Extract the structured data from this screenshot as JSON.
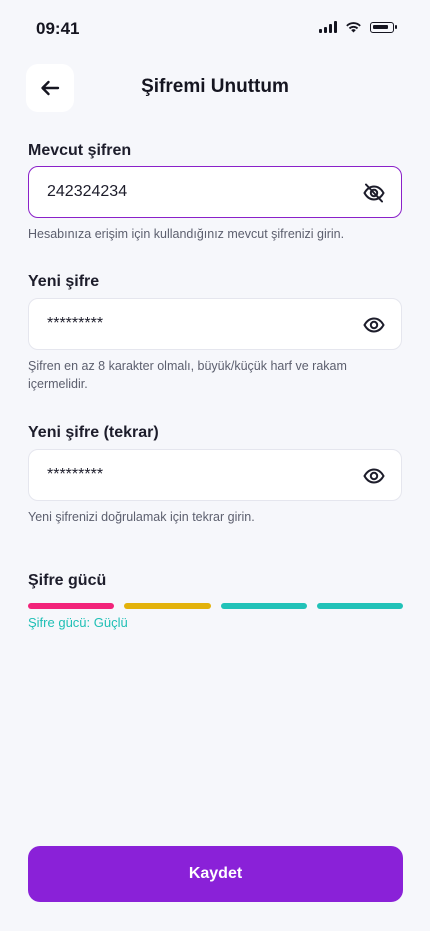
{
  "status_bar": {
    "time": "09:41"
  },
  "header": {
    "title": "Şifremi Unuttum",
    "back_icon": "arrow-left-icon"
  },
  "fields": {
    "current": {
      "label": "Mevcut şifren",
      "value": "242324234",
      "helper": "Hesabınıza erişim için kullandığınız mevcut şifrenizi girin.",
      "icon": "eye-off-icon"
    },
    "new": {
      "label": "Yeni şifre",
      "value": "*********",
      "helper": "Şifren en az 8 karakter olmalı, büyük/küçük harf ve rakam içermelidir.",
      "icon": "eye-icon"
    },
    "confirm": {
      "label": "Yeni şifre (tekrar)",
      "value": "*********",
      "helper": "Yeni şifrenizi doğrulamak için tekrar girin.",
      "icon": "eye-icon"
    }
  },
  "strength": {
    "label": "Şifre gücü",
    "status": "Şifre gücü: Güçlü",
    "segments": [
      "#f2237a",
      "#e3b20b",
      "#21c2b8",
      "#21c2b8"
    ]
  },
  "save_button": {
    "label": "Kaydet"
  },
  "colors": {
    "accent": "#8a21d8",
    "focus_border": "#8a21c9",
    "strong": "#1fbfb5"
  }
}
